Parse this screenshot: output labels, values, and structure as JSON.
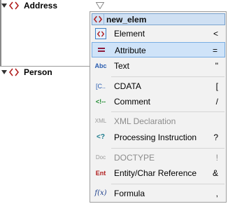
{
  "tree": {
    "address_label": "Address",
    "person_label": "Person"
  },
  "menu": {
    "header_label": "new_elem",
    "items": [
      {
        "label": "Element",
        "shortcut": "<"
      },
      {
        "label": "Attribute",
        "shortcut": "="
      },
      {
        "label": "Text",
        "shortcut": "\""
      },
      {
        "label": "CDATA",
        "shortcut": "["
      },
      {
        "label": "Comment",
        "shortcut": "/"
      },
      {
        "label": "XML Declaration",
        "shortcut": ""
      },
      {
        "label": "Processing Instruction",
        "shortcut": "?"
      },
      {
        "label": "DOCTYPE",
        "shortcut": "!"
      },
      {
        "label": "Entity/Char Reference",
        "shortcut": "&"
      },
      {
        "label": "Formula",
        "shortcut": ","
      }
    ],
    "icon_glyphs": {
      "text": "Abc",
      "cdata": "[C..",
      "comment": "<!--",
      "xml_declaration": "XML",
      "processing_instruction": "<?",
      "doctype": "Doc",
      "entity": "Ent",
      "formula": "f(x)"
    }
  },
  "colors": {
    "highlight": "#cfe3f8",
    "highlight_border": "#79aee3",
    "element_icon": "#b01c1c",
    "menu_bg": "#f2f2f2",
    "disabled_text": "#8c8c8c"
  }
}
